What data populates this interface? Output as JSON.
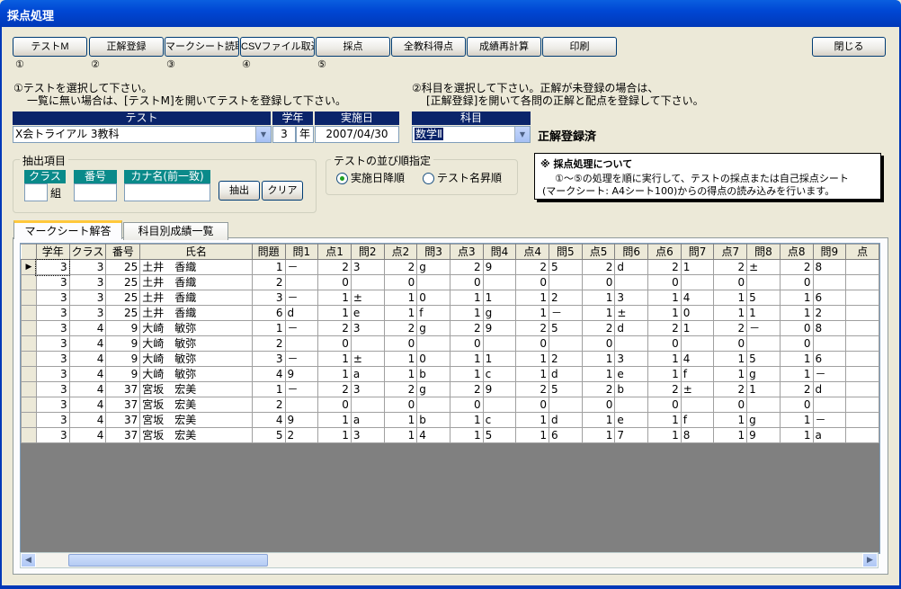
{
  "window": {
    "title": "採点処理"
  },
  "toolbar": {
    "buttons": [
      "テストM",
      "正解登録",
      "マークシート読取",
      "CSVファイル取込",
      "採点",
      "全教科得点",
      "成績再計算",
      "印刷"
    ],
    "close": "閉じる",
    "step_numbers": [
      "①",
      "②",
      "③",
      "④",
      "⑤"
    ]
  },
  "instructions": {
    "left_line1": "①テストを選択して下さい。",
    "left_line2": "一覧に無い場合は、[テストM]を開いてテストを登録して下さい。",
    "right_line1": "②科目を選択して下さい。正解が未登録の場合は、",
    "right_line2": "[正解登録]を開いて各問の正解と配点を登録して下さい。"
  },
  "test_select": {
    "headers": {
      "test": "テスト",
      "grade": "学年",
      "date": "実施日"
    },
    "test_value": "X会トライアル 3教科",
    "grade_value": "3",
    "grade_unit": "年",
    "date_value": "2007/04/30"
  },
  "subject_select": {
    "header": "科目",
    "value": "数学Ⅱ",
    "status": "正解登録済"
  },
  "extract": {
    "title": "抽出項目",
    "class_label": "クラス",
    "class_suffix": "組",
    "number_label": "番号",
    "kana_label": "カナ名(前一致)",
    "extract_button": "抽出",
    "clear_button": "クリア"
  },
  "sort": {
    "title": "テストの並び順指定",
    "option1": "実施日降順",
    "option2": "テスト名昇順",
    "selected": "実施日降順"
  },
  "note": {
    "title": "※ 採点処理について",
    "line1": "①～⑤の処理を順に実行して、テストの採点または自己採点シート",
    "line2": "(マークシート: A4シート100)からの得点の読み込みを行います。"
  },
  "tabs": [
    "マークシート解答",
    "科目別成績一覧"
  ],
  "grid": {
    "columns": [
      "学年",
      "クラス",
      "番号",
      "氏名",
      "問題",
      "問1",
      "点1",
      "問2",
      "点2",
      "問3",
      "点3",
      "問4",
      "点4",
      "問5",
      "点5",
      "問6",
      "点6",
      "問7",
      "点7",
      "問8",
      "点8",
      "問9",
      "点"
    ],
    "rows": [
      [
        "3",
        "3",
        "25",
        "土井　香織",
        "1",
        "－",
        "2",
        "3",
        "2",
        "g",
        "2",
        "9",
        "2",
        "5",
        "2",
        "d",
        "2",
        "1",
        "2",
        "±",
        "2",
        "8",
        ""
      ],
      [
        "3",
        "3",
        "25",
        "土井　香織",
        "2",
        "",
        "0",
        "",
        "0",
        "",
        "0",
        "",
        "0",
        "",
        "0",
        "",
        "0",
        "",
        "0",
        "",
        "0",
        "",
        ""
      ],
      [
        "3",
        "3",
        "25",
        "土井　香織",
        "3",
        "－",
        "1",
        "±",
        "1",
        "0",
        "1",
        "1",
        "1",
        "2",
        "1",
        "3",
        "1",
        "4",
        "1",
        "5",
        "1",
        "6",
        ""
      ],
      [
        "3",
        "3",
        "25",
        "土井　香織",
        "6",
        "d",
        "1",
        "e",
        "1",
        "f",
        "1",
        "g",
        "1",
        "－",
        "1",
        "±",
        "1",
        "0",
        "1",
        "1",
        "1",
        "2",
        ""
      ],
      [
        "3",
        "4",
        "9",
        "大崎　敏弥",
        "1",
        "－",
        "2",
        "3",
        "2",
        "g",
        "2",
        "9",
        "2",
        "5",
        "2",
        "d",
        "2",
        "1",
        "2",
        "－",
        "0",
        "8",
        ""
      ],
      [
        "3",
        "4",
        "9",
        "大崎　敏弥",
        "2",
        "",
        "0",
        "",
        "0",
        "",
        "0",
        "",
        "0",
        "",
        "0",
        "",
        "0",
        "",
        "0",
        "",
        "0",
        "",
        ""
      ],
      [
        "3",
        "4",
        "9",
        "大崎　敏弥",
        "3",
        "－",
        "1",
        "±",
        "1",
        "0",
        "1",
        "1",
        "1",
        "2",
        "1",
        "3",
        "1",
        "4",
        "1",
        "5",
        "1",
        "6",
        ""
      ],
      [
        "3",
        "4",
        "9",
        "大崎　敏弥",
        "4",
        "9",
        "1",
        "a",
        "1",
        "b",
        "1",
        "c",
        "1",
        "d",
        "1",
        "e",
        "1",
        "f",
        "1",
        "g",
        "1",
        "－",
        ""
      ],
      [
        "3",
        "4",
        "37",
        "宮坂　宏美",
        "1",
        "－",
        "2",
        "3",
        "2",
        "g",
        "2",
        "9",
        "2",
        "5",
        "2",
        "b",
        "2",
        "±",
        "2",
        "1",
        "2",
        "d",
        ""
      ],
      [
        "3",
        "4",
        "37",
        "宮坂　宏美",
        "2",
        "",
        "0",
        "",
        "0",
        "",
        "0",
        "",
        "0",
        "",
        "0",
        "",
        "0",
        "",
        "0",
        "",
        "0",
        "",
        ""
      ],
      [
        "3",
        "4",
        "37",
        "宮坂　宏美",
        "4",
        "9",
        "1",
        "a",
        "1",
        "b",
        "1",
        "c",
        "1",
        "d",
        "1",
        "e",
        "1",
        "f",
        "1",
        "g",
        "1",
        "－",
        ""
      ],
      [
        "3",
        "4",
        "37",
        "宮坂　宏美",
        "5",
        "2",
        "1",
        "3",
        "1",
        "4",
        "1",
        "5",
        "1",
        "6",
        "1",
        "7",
        "1",
        "8",
        "1",
        "9",
        "1",
        "a",
        ""
      ]
    ]
  }
}
